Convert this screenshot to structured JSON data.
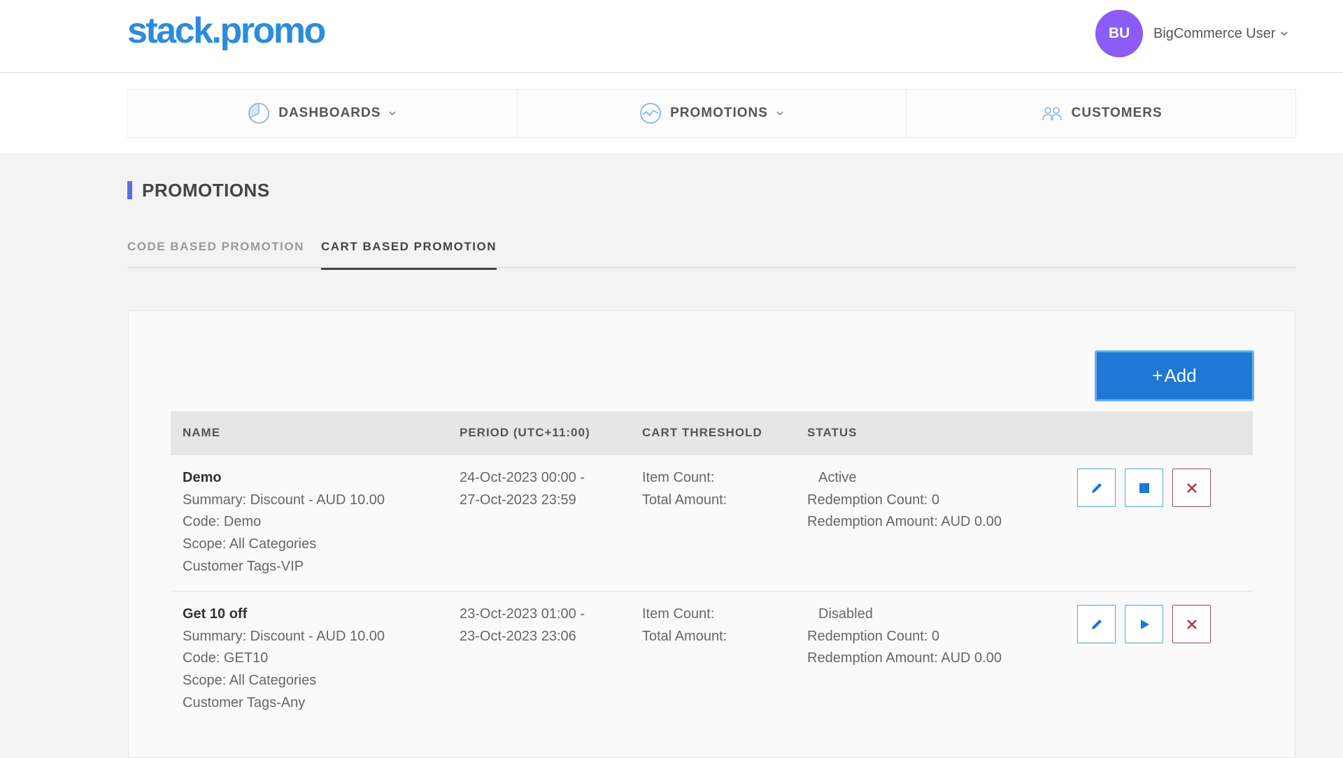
{
  "header": {
    "logo": "stack.promo",
    "user": {
      "initials": "BU",
      "name": "BigCommerce User"
    }
  },
  "nav": {
    "items": [
      {
        "label": "DASHBOARDS",
        "icon": "pie-chart-icon",
        "has_caret": true
      },
      {
        "label": "PROMOTIONS",
        "icon": "trend-line-icon",
        "has_caret": true
      },
      {
        "label": "CUSTOMERS",
        "icon": "users-icon",
        "has_caret": false
      }
    ]
  },
  "page": {
    "title": "PROMOTIONS",
    "tabs": [
      {
        "label": "CODE BASED PROMOTION",
        "active": false
      },
      {
        "label": "CART BASED PROMOTION",
        "active": true
      }
    ],
    "add_label": "Add"
  },
  "table": {
    "headers": [
      "NAME",
      "PERIOD (UTC+11:00)",
      "CART THRESHOLD",
      "STATUS"
    ],
    "rows": [
      {
        "name": "Demo",
        "summary": "Summary: Discount - AUD 10.00",
        "code": "Code: Demo",
        "scope": "Scope: All Categories",
        "tags": "Customer Tags-VIP",
        "period_start": "24-Oct-2023 00:00 -",
        "period_end": "27-Oct-2023 23:59",
        "item_count": "Item Count:",
        "total_amount": "Total Amount:",
        "status": "Active",
        "status_color": "#2eb82e",
        "redemption_count": "Redemption Count: 0",
        "redemption_amount": "Redemption Amount: AUD 0.00",
        "toggle_icon": "stop-icon"
      },
      {
        "name": "Get 10 off",
        "summary": "Summary: Discount - AUD 10.00",
        "code": "Code: GET10",
        "scope": "Scope: All Categories",
        "tags": "Customer Tags-Any",
        "period_start": "23-Oct-2023 01:00 -",
        "period_end": "23-Oct-2023 23:06",
        "item_count": "Item Count:",
        "total_amount": "Total Amount:",
        "status": "Disabled",
        "status_color": "#a8394a",
        "redemption_count": "Redemption Count: 0",
        "redemption_amount": "Redemption Amount: AUD 0.00",
        "toggle_icon": "play-icon"
      }
    ]
  },
  "colors": {
    "brand_blue": "#2d8bdb",
    "accent_purple": "#8b5cf6",
    "button_blue": "#1e78d4",
    "delete_red": "#a8394a"
  }
}
